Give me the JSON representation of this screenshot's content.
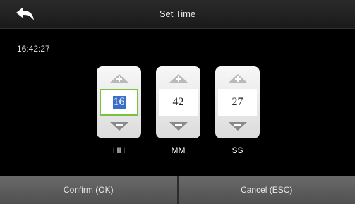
{
  "header": {
    "title": "Set Time",
    "back_icon": "back-arrow-icon"
  },
  "clock": "16:42:27",
  "spinners": [
    {
      "value": "16",
      "label": "HH"
    },
    {
      "value": "42",
      "label": "MM"
    },
    {
      "value": "27",
      "label": "SS"
    }
  ],
  "footer": {
    "confirm": "Confirm (OK)",
    "cancel": "Cancel (ESC)"
  },
  "colors": {
    "focus": "#7ac142",
    "selection": "#3a6fc9"
  }
}
